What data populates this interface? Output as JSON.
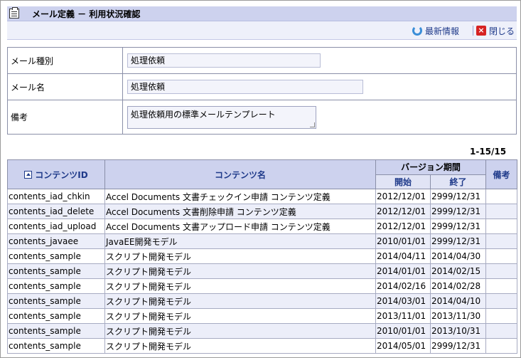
{
  "window": {
    "title": "メール定義 － 利用状況確認"
  },
  "toolbar": {
    "refresh_label": "最新情報",
    "close_label": "閉じる"
  },
  "form": {
    "mail_type_label": "メール種別",
    "mail_type_value": "処理依頼",
    "mail_name_label": "メール名",
    "mail_name_value": "処理依頼",
    "note_label": "備考",
    "note_value": "処理依頼用の標準メールテンプレート"
  },
  "paging": {
    "count": "1-15/15"
  },
  "table": {
    "headers": {
      "content_id": "コンテンツID",
      "content_name": "コンテンツ名",
      "version_period": "バージョン期間",
      "start": "開始",
      "end": "終了",
      "note": "備考"
    },
    "rows": [
      {
        "id": "contents_iad_chkin",
        "name": "Accel Documents 文書チェックイン申請 コンテンツ定義",
        "start": "2012/12/01",
        "end": "2999/12/31",
        "note": ""
      },
      {
        "id": "contents_iad_delete",
        "name": "Accel Documents 文書削除申請 コンテンツ定義",
        "start": "2012/12/01",
        "end": "2999/12/31",
        "note": ""
      },
      {
        "id": "contents_iad_upload",
        "name": "Accel Documents 文書アップロード申請 コンテンツ定義",
        "start": "2012/12/01",
        "end": "2999/12/31",
        "note": ""
      },
      {
        "id": "contents_javaee",
        "name": "JavaEE開発モデル",
        "start": "2010/01/01",
        "end": "2999/12/31",
        "note": ""
      },
      {
        "id": "contents_sample",
        "name": "スクリプト開発モデル",
        "start": "2014/04/11",
        "end": "2014/04/30",
        "note": ""
      },
      {
        "id": "contents_sample",
        "name": "スクリプト開発モデル",
        "start": "2014/01/01",
        "end": "2014/02/15",
        "note": ""
      },
      {
        "id": "contents_sample",
        "name": "スクリプト開発モデル",
        "start": "2014/02/16",
        "end": "2014/02/28",
        "note": ""
      },
      {
        "id": "contents_sample",
        "name": "スクリプト開発モデル",
        "start": "2014/03/01",
        "end": "2014/04/10",
        "note": ""
      },
      {
        "id": "contents_sample",
        "name": "スクリプト開発モデル",
        "start": "2013/11/01",
        "end": "2013/11/30",
        "note": ""
      },
      {
        "id": "contents_sample",
        "name": "スクリプト開発モデル",
        "start": "2010/01/01",
        "end": "2013/10/31",
        "note": ""
      },
      {
        "id": "contents_sample",
        "name": "スクリプト開発モデル",
        "start": "2014/05/01",
        "end": "2999/12/31",
        "note": ""
      }
    ]
  }
}
